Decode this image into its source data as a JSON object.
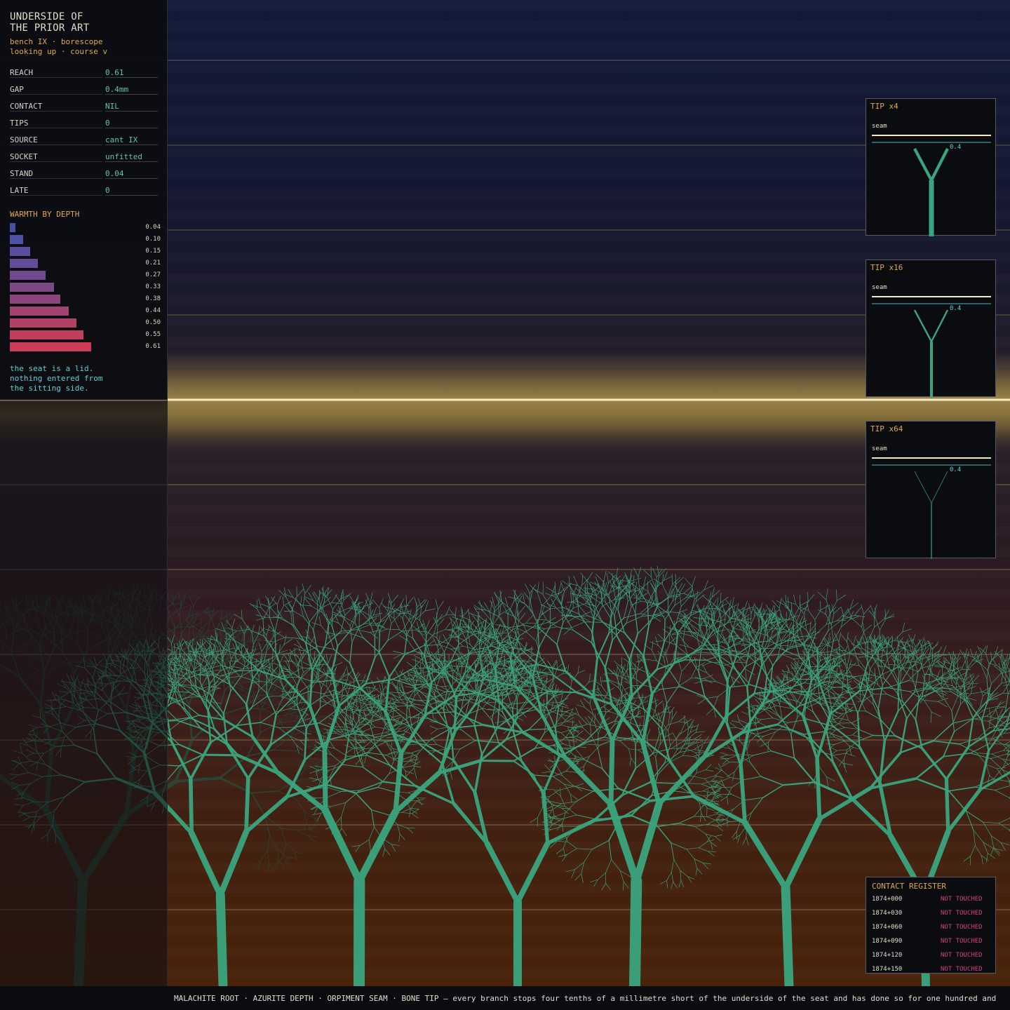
{
  "header": {
    "title": "UNDERSIDE OF\nTHE PRIOR ART",
    "subtitle": "bench IX · borescope\nlooking up · course v"
  },
  "stats": [
    {
      "label": "REACH",
      "value": "0.61"
    },
    {
      "label": "GAP",
      "value": "0.4mm"
    },
    {
      "label": "CONTACT",
      "value": "NIL"
    },
    {
      "label": "TIPS",
      "value": "0"
    },
    {
      "label": "SOURCE",
      "value": "cant IX"
    },
    {
      "label": "SOCKET",
      "value": "unfitted"
    },
    {
      "label": "STAND",
      "value": "0.04"
    },
    {
      "label": "LATE",
      "value": "0"
    }
  ],
  "warmth": {
    "title": "WARMTH BY DEPTH",
    "values": [
      "0.04",
      "0.10",
      "0.15",
      "0.21",
      "0.27",
      "0.33",
      "0.38",
      "0.44",
      "0.50",
      "0.55",
      "0.61"
    ],
    "colors": [
      "#4a4fa6",
      "#5151a6",
      "#5a4f9e",
      "#644c96",
      "#6e4a8e",
      "#7c4886",
      "#8c457c",
      "#a04370",
      "#b24166",
      "#c03f5c",
      "#cc3d55"
    ]
  },
  "note": "the seat is a lid.\nnothing entered from\nthe sitting side.",
  "tips": [
    {
      "title": "TIP x4",
      "seam_label": "seam",
      "gap_label": "0.4"
    },
    {
      "title": "TIP x16",
      "seam_label": "seam",
      "gap_label": "0.4"
    },
    {
      "title": "TIP x64",
      "seam_label": "seam",
      "gap_label": "0.4"
    }
  ],
  "register": {
    "title": "CONTACT REGISTER",
    "rows": [
      {
        "code": "1874+000",
        "status": "NOT TOUCHED"
      },
      {
        "code": "1874+030",
        "status": "NOT TOUCHED"
      },
      {
        "code": "1874+060",
        "status": "NOT TOUCHED"
      },
      {
        "code": "1874+090",
        "status": "NOT TOUCHED"
      },
      {
        "code": "1874+120",
        "status": "NOT TOUCHED"
      },
      {
        "code": "1874+150",
        "status": "NOT TOUCHED"
      }
    ]
  },
  "footer": {
    "text": "MALACHITE ROOT · AZURITE DEPTH · ORPIMENT SEAM · BONE TIP  —  every branch stops four tenths of a millimetre short of the underside of the seat and has done so for one hundred and"
  },
  "colors": {
    "branch": "#3aa57e",
    "seam": "#f6ecc4",
    "accent": "#e0a94c",
    "value": "#5fc79b",
    "alert": "#d0407a"
  }
}
